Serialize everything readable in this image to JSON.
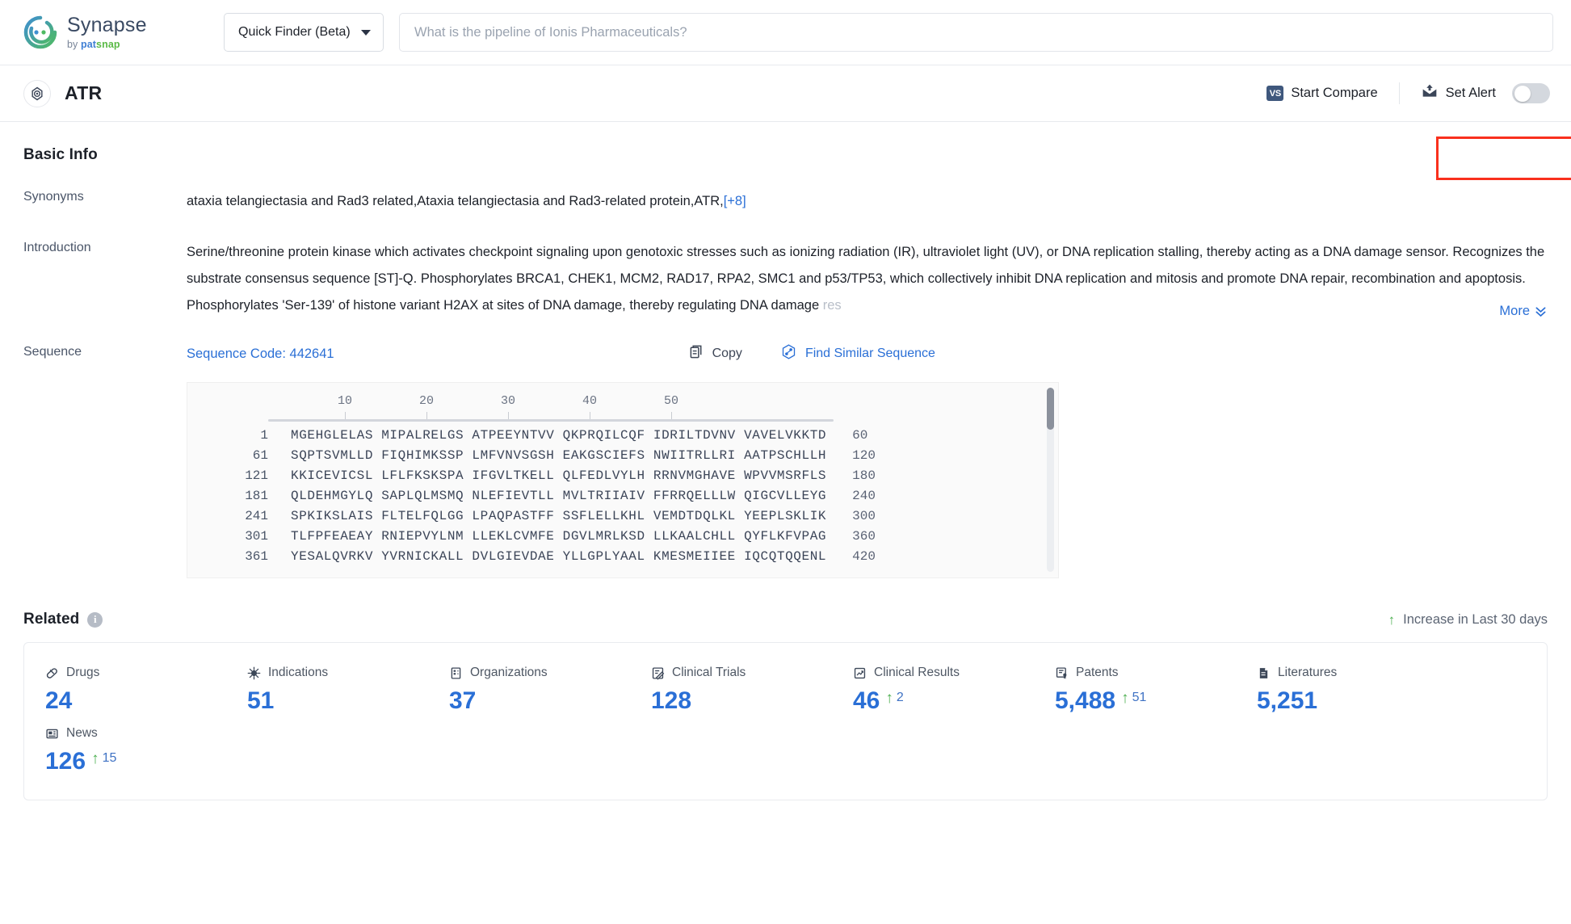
{
  "brand": {
    "name": "Synapse",
    "sub_prefix": "by ",
    "sub_pat": "pat",
    "sub_snap": "snap"
  },
  "topbar": {
    "finder_label": "Quick Finder (Beta)",
    "search_placeholder": "What is the pipeline of Ionis Pharmaceuticals?",
    "search_value": ""
  },
  "subheader": {
    "entity_title": "ATR",
    "start_compare": "Start Compare",
    "vs_badge": "VS",
    "set_alert": "Set Alert"
  },
  "basic_info": {
    "title": "Basic Info",
    "synonyms_label": "Synonyms",
    "synonyms_value": "ataxia telangiectasia and Rad3 related,Ataxia telangiectasia and Rad3-related protein,ATR,",
    "synonyms_more": "[+8]",
    "introduction_label": "Introduction",
    "introduction_text": "Serine/threonine protein kinase which activates checkpoint signaling upon genotoxic stresses such as ionizing radiation (IR), ultraviolet light (UV), or DNA replication stalling, thereby acting as a DNA damage sensor. Recognizes the substrate consensus sequence [ST]-Q. Phosphorylates BRCA1, CHEK1, MCM2, RAD17, RPA2, SMC1 and p53/TP53, which collectively inhibit DNA replication and mitosis and promote DNA repair, recombination and apoptosis. Phosphorylates 'Ser-139' of histone variant H2AX at sites of DNA damage, thereby regulating DNA damage ",
    "introduction_fade": "res",
    "more_label": "More"
  },
  "sequence": {
    "label": "Sequence",
    "code_label": "Sequence Code: 442641",
    "copy_label": "Copy",
    "similar_label": "Find Similar Sequence",
    "ruler_ticks": [
      10,
      20,
      30,
      40,
      50
    ],
    "rows": [
      {
        "start": "1",
        "chunks": "MGEHGLELAS MIPALRELGS ATPEEYNTVV QKPRQILCQF IDRILTDVNV VAVELVKKTD",
        "end": "60"
      },
      {
        "start": "61",
        "chunks": "SQPTSVMLLD FIQHIMKSSP LMFVNVSGSH EAKGSCIEFS NWIITRLLRI AATPSCHLLH",
        "end": "120"
      },
      {
        "start": "121",
        "chunks": "KKICEVICSL LFLFKSKSPA IFGVLTKELL QLFEDLVYLH RRNVMGHAVE WPVVMSRFLS",
        "end": "180"
      },
      {
        "start": "181",
        "chunks": "QLDEHMGYLQ SAPLQLMSMQ NLEFIEVTLL MVLTRIIAIV FFRRQELLLW QIGCVLLEYG",
        "end": "240"
      },
      {
        "start": "241",
        "chunks": "SPKIKSLAIS FLTELFQLGG LPAQPASTFF SSFLELLKHL VEMDTDQLKL YEEPLSKLIK",
        "end": "300"
      },
      {
        "start": "301",
        "chunks": "TLFPFEAEAY RNIEPVYLNM LLEKLCVMFE DGVLMRLKSD LLKAALCHLL QYFLKFVPAG",
        "end": "360"
      },
      {
        "start": "361",
        "chunks": "YESALQVRKV YVRNICKALL DVLGIEVDAE YLLGPLYAAL KMESMEIIEE IQCQTQQENL",
        "end": "420"
      }
    ]
  },
  "related": {
    "title": "Related",
    "legend": "Increase in Last 30 days",
    "stats": [
      {
        "icon": "pill-icon",
        "label": "Drugs",
        "value": "24",
        "delta": ""
      },
      {
        "icon": "virus-icon",
        "label": "Indications",
        "value": "51",
        "delta": ""
      },
      {
        "icon": "building-icon",
        "label": "Organizations",
        "value": "37",
        "delta": ""
      },
      {
        "icon": "clinical-trial-icon",
        "label": "Clinical Trials",
        "value": "128",
        "delta": ""
      },
      {
        "icon": "clinical-result-icon",
        "label": "Clinical Results",
        "value": "46",
        "delta": "2"
      },
      {
        "icon": "patent-icon",
        "label": "Patents",
        "value": "5,488",
        "delta": "51"
      },
      {
        "icon": "literature-icon",
        "label": "Literatures",
        "value": "5,251",
        "delta": ""
      },
      {
        "icon": "news-icon",
        "label": "News",
        "value": "126",
        "delta": "15"
      }
    ]
  },
  "colors": {
    "accent_blue": "#2a6fd6",
    "value_blue": "#2a6fd6",
    "increase_green": "#4caf50",
    "highlight_red": "#f9301d",
    "label_gray": "#4a5568"
  }
}
